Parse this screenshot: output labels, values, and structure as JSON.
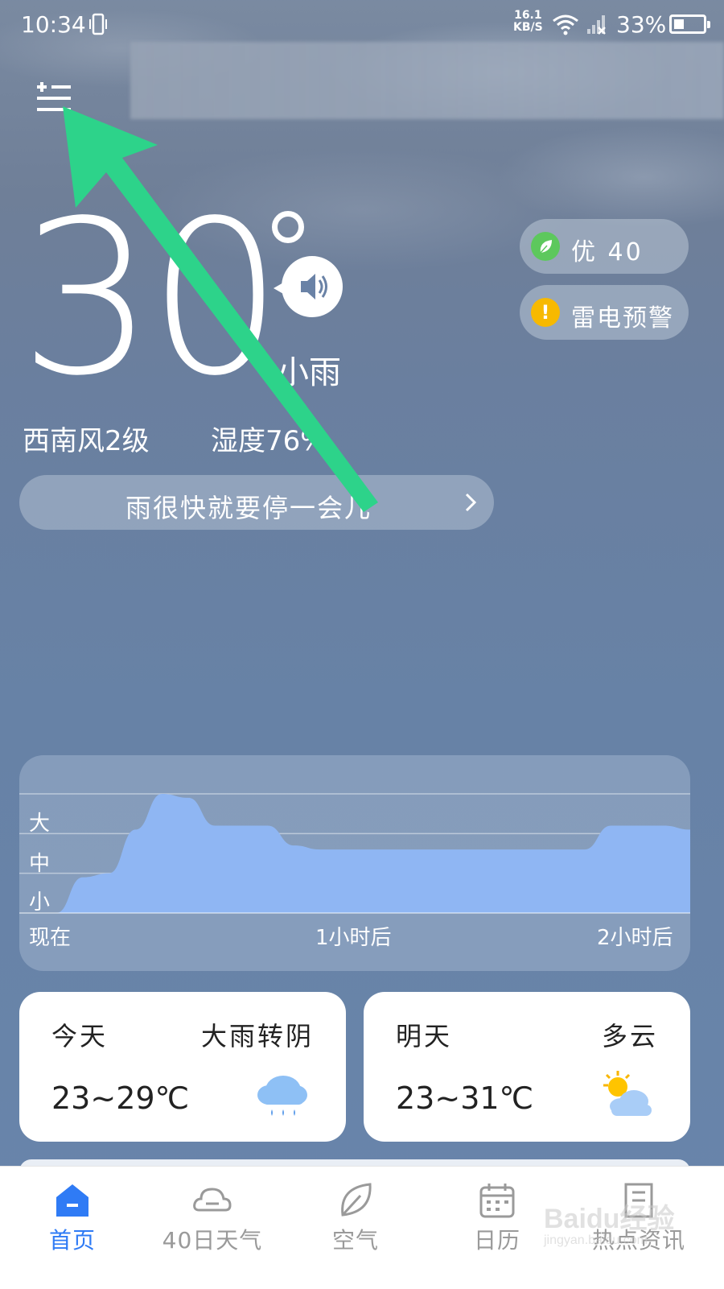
{
  "status_bar": {
    "time": "10:34",
    "net_speed_value": "16.1",
    "net_speed_unit": "KB/S",
    "battery": "33%"
  },
  "current": {
    "temperature": "30",
    "condition": "小雨",
    "wind": "西南风2级",
    "humidity": "湿度76%",
    "tip": "雨很快就要停一会儿"
  },
  "air_quality": {
    "label": "优 40"
  },
  "alert": {
    "label": "雷电预警"
  },
  "precip_chart": {
    "levels": [
      "大",
      "中",
      "小"
    ],
    "x_labels": [
      "现在",
      "1小时后",
      "2小时后"
    ]
  },
  "chart_data": {
    "type": "area",
    "title": "",
    "x": [
      0,
      5,
      10,
      15,
      20,
      25,
      30,
      35,
      40,
      45,
      50,
      55,
      60,
      65,
      70,
      75,
      80,
      85,
      90,
      95,
      100,
      105,
      110,
      115,
      120
    ],
    "y": [
      0.0,
      0.9,
      1.0,
      2.1,
      3.0,
      2.9,
      2.2,
      2.2,
      2.2,
      1.7,
      1.6,
      1.6,
      1.6,
      1.6,
      1.6,
      1.6,
      1.6,
      1.6,
      1.6,
      1.6,
      1.6,
      2.2,
      2.2,
      2.2,
      2.1
    ],
    "y_levels": [
      "小",
      "中",
      "大"
    ],
    "ylim": [
      0,
      3
    ],
    "x_tick_labels": [
      "现在",
      "1小时后",
      "2小时后"
    ],
    "fill_color": "#8fb6f3"
  },
  "days": [
    {
      "name": "今天",
      "condition": "大雨转阴",
      "range": "23~29℃",
      "icon": "rain-cloud-icon"
    },
    {
      "name": "明天",
      "condition": "多云",
      "range": "23~31℃",
      "icon": "partly-cloudy-icon"
    }
  ],
  "nav": [
    {
      "label": "首页",
      "icon": "home-icon",
      "active": true
    },
    {
      "label": "40日天气",
      "icon": "cloud-icon",
      "active": false
    },
    {
      "label": "空气",
      "icon": "leaf-icon",
      "active": false
    },
    {
      "label": "日历",
      "icon": "calendar-icon",
      "active": false
    },
    {
      "label": "热点资讯",
      "icon": "news-icon",
      "active": false
    }
  ],
  "watermark": {
    "logo": "Baidu经验",
    "sub": "jingyan.baidu.com"
  },
  "colors": {
    "accent": "#2f7bf5",
    "arrow": "#2dd38a",
    "aqi_green": "#5dc85d",
    "alert_yellow": "#f7b900"
  }
}
